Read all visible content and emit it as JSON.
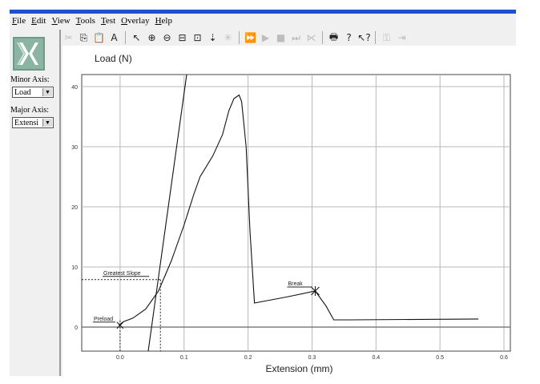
{
  "menu": [
    {
      "label": "File"
    },
    {
      "label": "Edit"
    },
    {
      "label": "View"
    },
    {
      "label": "Tools"
    },
    {
      "label": "Test"
    },
    {
      "label": "Overlay"
    },
    {
      "label": "Help"
    }
  ],
  "toolbar": {
    "items": [
      {
        "name": "cut-icon",
        "glyph": "✂",
        "enabled": false
      },
      {
        "name": "copy-icon",
        "glyph": "⎘",
        "enabled": true
      },
      {
        "name": "paste-icon",
        "glyph": "📋",
        "enabled": true
      },
      {
        "name": "text-tool-icon",
        "glyph": "A",
        "enabled": true
      },
      {
        "sep": true
      },
      {
        "name": "pointer-icon",
        "glyph": "↖",
        "enabled": true
      },
      {
        "name": "zoom-in-icon",
        "glyph": "⊕",
        "enabled": true
      },
      {
        "name": "zoom-out-icon",
        "glyph": "⊖",
        "enabled": true
      },
      {
        "name": "zoom-box-icon",
        "glyph": "⊟",
        "enabled": true
      },
      {
        "name": "zoom-fit-icon",
        "glyph": "⊡",
        "enabled": true
      },
      {
        "name": "marker-icon",
        "glyph": "⇣",
        "enabled": true
      },
      {
        "name": "asterisk-icon",
        "glyph": "✳",
        "enabled": false
      },
      {
        "sep": true
      },
      {
        "name": "fast-forward-icon",
        "glyph": "⏩",
        "enabled": false
      },
      {
        "name": "play-icon",
        "glyph": "▶",
        "enabled": false
      },
      {
        "name": "stop-icon",
        "glyph": "■",
        "enabled": false
      },
      {
        "name": "skip-icon",
        "glyph": "⏭",
        "enabled": false
      },
      {
        "name": "reset-icon",
        "glyph": "⋉",
        "enabled": false
      },
      {
        "sep": true
      },
      {
        "name": "print-icon",
        "glyph": "🖶",
        "enabled": true
      },
      {
        "name": "help-icon",
        "glyph": "?",
        "enabled": true
      },
      {
        "name": "context-help-icon",
        "glyph": "↖?",
        "enabled": true
      },
      {
        "sep": true
      },
      {
        "name": "lock-icon",
        "glyph": "⚿",
        "enabled": false
      },
      {
        "name": "exit-icon",
        "glyph": "⇥",
        "enabled": false
      }
    ]
  },
  "sidebar": {
    "minor_axis_label": "Minor Axis:",
    "minor_axis_value": "Load",
    "major_axis_label": "Major Axis:",
    "major_axis_value": "Extensi"
  },
  "colors": {
    "title_strip": "#1f4fd1",
    "logo": "#8cb4a4",
    "panel": "#f0f0f0"
  },
  "chart_data": {
    "type": "line",
    "ylabel": "Load (N)",
    "xlabel": "Extension (mm)",
    "xlim": [
      -0.06,
      0.61
    ],
    "ylim": [
      -4,
      42
    ],
    "xticks": [
      0.0,
      0.1,
      0.2,
      0.3,
      0.4,
      0.5,
      0.6
    ],
    "xtick_labels": [
      "0.0",
      "0.1",
      "0.2",
      "0.3",
      "0.4",
      "0.5",
      "0.6"
    ],
    "yticks": [
      0,
      10,
      20,
      30,
      40
    ],
    "ytick_labels": [
      "0",
      "10",
      "20",
      "30",
      "40"
    ],
    "grid": true,
    "series": [
      {
        "values": [
          [
            -0.002,
            0.3
          ],
          [
            0.005,
            0.9
          ],
          [
            0.02,
            1.5
          ],
          [
            0.04,
            3.0
          ],
          [
            0.06,
            6.0
          ],
          [
            0.08,
            11.0
          ],
          [
            0.1,
            17.0
          ],
          [
            0.115,
            22.0
          ],
          [
            0.125,
            25.0
          ],
          [
            0.145,
            28.5
          ],
          [
            0.16,
            32.0
          ],
          [
            0.17,
            36.0
          ],
          [
            0.178,
            38.0
          ],
          [
            0.186,
            38.6
          ],
          [
            0.19,
            37.5
          ],
          [
            0.197,
            30.0
          ],
          [
            0.203,
            16.0
          ],
          [
            0.21,
            4.0
          ],
          [
            0.26,
            5.0
          ],
          [
            0.305,
            6.0
          ],
          [
            0.322,
            3.5
          ],
          [
            0.334,
            1.2
          ],
          [
            0.36,
            1.2
          ],
          [
            0.56,
            1.35
          ]
        ]
      },
      {
        "values": [
          [
            0.044,
            -4.0
          ],
          [
            0.104,
            42.0
          ]
        ]
      }
    ],
    "annotations": [
      {
        "text": "Greatest Slope",
        "x": 0.063,
        "y": 7.9
      },
      {
        "text": "Break",
        "x": 0.305,
        "y": 6.0
      },
      {
        "text": "Preload",
        "x": 0.0,
        "y": 0.3
      }
    ]
  }
}
